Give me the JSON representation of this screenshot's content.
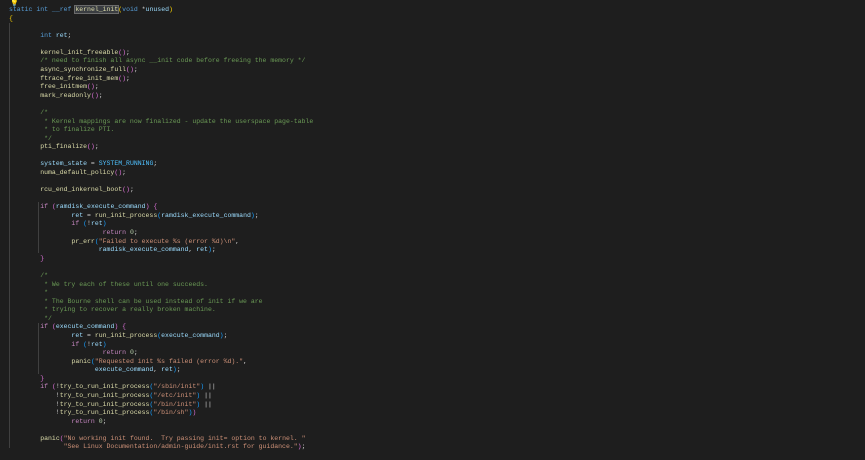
{
  "editor": {
    "language": "c",
    "indicator_icon": "lightbulb-icon",
    "lines": [
      [
        [
          "kw",
          "static"
        ],
        [
          "p",
          " "
        ],
        [
          "kw",
          "int"
        ],
        [
          "p",
          " "
        ],
        [
          "kw",
          "__ref"
        ],
        [
          "p",
          " "
        ],
        [
          "fnhl",
          "kernel_init"
        ],
        [
          "br1",
          "("
        ],
        [
          "kw",
          "void"
        ],
        [
          "p",
          " *"
        ],
        [
          "var",
          "unused"
        ],
        [
          "br1",
          ")"
        ]
      ],
      [
        [
          "br1",
          "{"
        ]
      ],
      [],
      [
        [
          "p",
          "        "
        ],
        [
          "kw",
          "int"
        ],
        [
          "p",
          " "
        ],
        [
          "var",
          "ret"
        ],
        [
          "p",
          ";"
        ]
      ],
      [],
      [
        [
          "p",
          "        "
        ],
        [
          "fn",
          "kernel_init_freeable"
        ],
        [
          "br2",
          "()"
        ],
        [
          "p",
          ";"
        ]
      ],
      [
        [
          "p",
          "        "
        ],
        [
          "cmt",
          "/* need to finish all async __init code before freeing the memory */"
        ]
      ],
      [
        [
          "p",
          "        "
        ],
        [
          "fn",
          "async_synchronize_full"
        ],
        [
          "br2",
          "()"
        ],
        [
          "p",
          ";"
        ]
      ],
      [
        [
          "p",
          "        "
        ],
        [
          "fn",
          "ftrace_free_init_mem"
        ],
        [
          "br2",
          "()"
        ],
        [
          "p",
          ";"
        ]
      ],
      [
        [
          "p",
          "        "
        ],
        [
          "fn",
          "free_initmem"
        ],
        [
          "br2",
          "()"
        ],
        [
          "p",
          ";"
        ]
      ],
      [
        [
          "p",
          "        "
        ],
        [
          "fn",
          "mark_readonly"
        ],
        [
          "br2",
          "()"
        ],
        [
          "p",
          ";"
        ]
      ],
      [],
      [
        [
          "p",
          "        "
        ],
        [
          "cmt",
          "/*"
        ]
      ],
      [
        [
          "p",
          "        "
        ],
        [
          "cmt",
          " * Kernel mappings are now finalized - update the userspace page-table"
        ]
      ],
      [
        [
          "p",
          "        "
        ],
        [
          "cmt",
          " * to finalize PTI."
        ]
      ],
      [
        [
          "p",
          "        "
        ],
        [
          "cmt",
          " */"
        ]
      ],
      [
        [
          "p",
          "        "
        ],
        [
          "fn",
          "pti_finalize"
        ],
        [
          "br2",
          "()"
        ],
        [
          "p",
          ";"
        ]
      ],
      [],
      [
        [
          "p",
          "        "
        ],
        [
          "var",
          "system_state"
        ],
        [
          "p",
          " = "
        ],
        [
          "mac",
          "SYSTEM_RUNNING"
        ],
        [
          "p",
          ";"
        ]
      ],
      [
        [
          "p",
          "        "
        ],
        [
          "fn",
          "numa_default_policy"
        ],
        [
          "br2",
          "()"
        ],
        [
          "p",
          ";"
        ]
      ],
      [],
      [
        [
          "p",
          "        "
        ],
        [
          "fn",
          "rcu_end_inkernel_boot"
        ],
        [
          "br2",
          "()"
        ],
        [
          "p",
          ";"
        ]
      ],
      [],
      [
        [
          "p",
          "        "
        ],
        [
          "ctl",
          "if"
        ],
        [
          "p",
          " "
        ],
        [
          "br2",
          "("
        ],
        [
          "var",
          "ramdisk_execute_command"
        ],
        [
          "br2",
          ")"
        ],
        [
          "p",
          " "
        ],
        [
          "br2",
          "{"
        ]
      ],
      [
        [
          "p",
          "                "
        ],
        [
          "var",
          "ret"
        ],
        [
          "p",
          " = "
        ],
        [
          "fn",
          "run_init_process"
        ],
        [
          "br3",
          "("
        ],
        [
          "var",
          "ramdisk_execute_command"
        ],
        [
          "br3",
          ")"
        ],
        [
          "p",
          ";"
        ]
      ],
      [
        [
          "p",
          "                "
        ],
        [
          "ctl",
          "if"
        ],
        [
          "p",
          " "
        ],
        [
          "br3",
          "("
        ],
        [
          "p",
          "!"
        ],
        [
          "var",
          "ret"
        ],
        [
          "br3",
          ")"
        ]
      ],
      [
        [
          "p",
          "                        "
        ],
        [
          "ctl",
          "return"
        ],
        [
          "p",
          " "
        ],
        [
          "num",
          "0"
        ],
        [
          "p",
          ";"
        ]
      ],
      [
        [
          "p",
          "                "
        ],
        [
          "fn",
          "pr_err"
        ],
        [
          "br3",
          "("
        ],
        [
          "str",
          "\"Failed to execute %s (error %d)\\n\""
        ],
        [
          "p",
          ","
        ]
      ],
      [
        [
          "p",
          "                       "
        ],
        [
          "var",
          "ramdisk_execute_command"
        ],
        [
          "p",
          ", "
        ],
        [
          "var",
          "ret"
        ],
        [
          "br3",
          ")"
        ],
        [
          "p",
          ";"
        ]
      ],
      [
        [
          "p",
          "        "
        ],
        [
          "br2",
          "}"
        ]
      ],
      [],
      [
        [
          "p",
          "        "
        ],
        [
          "cmt",
          "/*"
        ]
      ],
      [
        [
          "p",
          "        "
        ],
        [
          "cmt",
          " * We try each of these until one succeeds."
        ]
      ],
      [
        [
          "p",
          "        "
        ],
        [
          "cmt",
          " *"
        ]
      ],
      [
        [
          "p",
          "        "
        ],
        [
          "cmt",
          " * The Bourne shell can be used instead of init if we are"
        ]
      ],
      [
        [
          "p",
          "        "
        ],
        [
          "cmt",
          " * trying to recover a really broken machine."
        ]
      ],
      [
        [
          "p",
          "        "
        ],
        [
          "cmt",
          " */"
        ]
      ],
      [
        [
          "p",
          "        "
        ],
        [
          "ctl",
          "if"
        ],
        [
          "p",
          " "
        ],
        [
          "br2",
          "("
        ],
        [
          "var",
          "execute_command"
        ],
        [
          "br2",
          ")"
        ],
        [
          "p",
          " "
        ],
        [
          "br2",
          "{"
        ]
      ],
      [
        [
          "p",
          "                "
        ],
        [
          "var",
          "ret"
        ],
        [
          "p",
          " = "
        ],
        [
          "fn",
          "run_init_process"
        ],
        [
          "br3",
          "("
        ],
        [
          "var",
          "execute_command"
        ],
        [
          "br3",
          ")"
        ],
        [
          "p",
          ";"
        ]
      ],
      [
        [
          "p",
          "                "
        ],
        [
          "ctl",
          "if"
        ],
        [
          "p",
          " "
        ],
        [
          "br3",
          "("
        ],
        [
          "p",
          "!"
        ],
        [
          "var",
          "ret"
        ],
        [
          "br3",
          ")"
        ]
      ],
      [
        [
          "p",
          "                        "
        ],
        [
          "ctl",
          "return"
        ],
        [
          "p",
          " "
        ],
        [
          "num",
          "0"
        ],
        [
          "p",
          ";"
        ]
      ],
      [
        [
          "p",
          "                "
        ],
        [
          "fn",
          "panic"
        ],
        [
          "br3",
          "("
        ],
        [
          "str",
          "\"Requested init %s failed (error %d).\""
        ],
        [
          "p",
          ","
        ]
      ],
      [
        [
          "p",
          "                      "
        ],
        [
          "var",
          "execute_command"
        ],
        [
          "p",
          ", "
        ],
        [
          "var",
          "ret"
        ],
        [
          "br3",
          ")"
        ],
        [
          "p",
          ";"
        ]
      ],
      [
        [
          "p",
          "        "
        ],
        [
          "br2",
          "}"
        ]
      ],
      [
        [
          "p",
          "        "
        ],
        [
          "ctl",
          "if"
        ],
        [
          "p",
          " "
        ],
        [
          "br2",
          "("
        ],
        [
          "p",
          "!"
        ],
        [
          "fn",
          "try_to_run_init_process"
        ],
        [
          "br3",
          "("
        ],
        [
          "str",
          "\"/sbin/init\""
        ],
        [
          "br3",
          ")"
        ],
        [
          "p",
          " ||"
        ]
      ],
      [
        [
          "p",
          "            !"
        ],
        [
          "fn",
          "try_to_run_init_process"
        ],
        [
          "br3",
          "("
        ],
        [
          "str",
          "\"/etc/init\""
        ],
        [
          "br3",
          ")"
        ],
        [
          "p",
          " ||"
        ]
      ],
      [
        [
          "p",
          "            !"
        ],
        [
          "fn",
          "try_to_run_init_process"
        ],
        [
          "br3",
          "("
        ],
        [
          "str",
          "\"/bin/init\""
        ],
        [
          "br3",
          ")"
        ],
        [
          "p",
          " ||"
        ]
      ],
      [
        [
          "p",
          "            !"
        ],
        [
          "fn",
          "try_to_run_init_process"
        ],
        [
          "br3",
          "("
        ],
        [
          "str",
          "\"/bin/sh\""
        ],
        [
          "br3",
          ")"
        ],
        [
          "br2",
          ")"
        ]
      ],
      [
        [
          "p",
          "                "
        ],
        [
          "ctl",
          "return"
        ],
        [
          "p",
          " "
        ],
        [
          "num",
          "0"
        ],
        [
          "p",
          ";"
        ]
      ],
      [],
      [
        [
          "p",
          "        "
        ],
        [
          "fn",
          "panic"
        ],
        [
          "br2",
          "("
        ],
        [
          "str",
          "\"No working init found.  Try passing init= option to kernel. \""
        ]
      ],
      [
        [
          "p",
          "              "
        ],
        [
          "str",
          "\"See Linux Documentation/admin-guide/init.rst for guidance.\""
        ],
        [
          "br2",
          ")"
        ],
        [
          "p",
          ";"
        ]
      ],
      [],
      [
        [
          "br1",
          "}"
        ]
      ]
    ]
  }
}
